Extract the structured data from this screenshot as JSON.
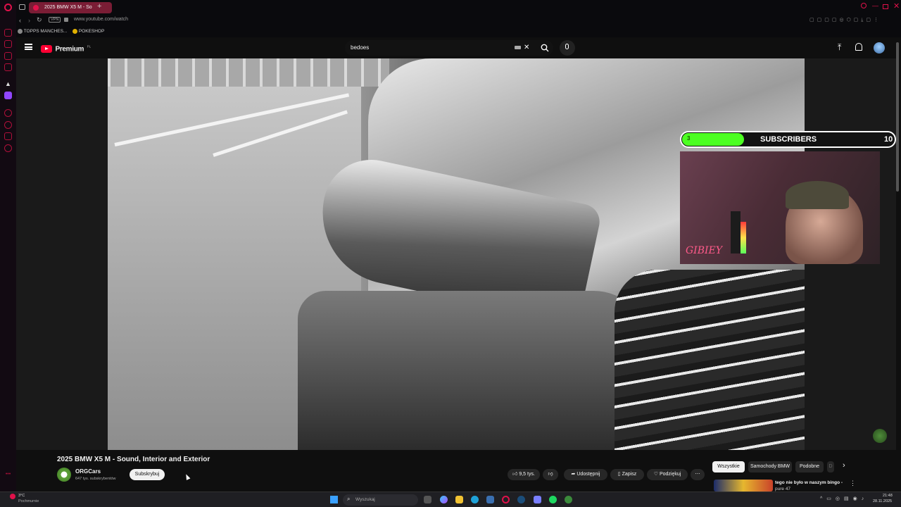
{
  "browser": {
    "tab_title": "2025 BMW X5 M - So",
    "url": "www.youtube.com/watch",
    "vpn_badge": "VPN",
    "bookmarks": [
      "TOPPS MANCHES...",
      "POKESHOP"
    ]
  },
  "header": {
    "logo_text": "Premium",
    "logo_region": "PL",
    "search_value": "bedoes"
  },
  "overlay": {
    "subscribers_current": "3",
    "subscribers_label": "SUBSCRIBERS",
    "subscribers_goal": "10",
    "webcam_caption": "GIBIEY"
  },
  "video": {
    "title": "2025 BMW X5 M - Sound, Interior and Exterior",
    "channel_name": "ORGCars",
    "channel_subs": "647 tys. subskrybentów",
    "subscribe_label": "Subskrybuj",
    "like_count": "9,5 tys.",
    "share_label": "Udostępnij",
    "save_label": "Zapisz",
    "thanks_label": "Podziękuj"
  },
  "chips": [
    "Wszystkie",
    "Samochody BMW",
    "Podobne",
    "D"
  ],
  "recommendation": {
    "title": "tego nie było w naszym bingo -",
    "subtitle": "pure 47"
  },
  "taskbar": {
    "weather_temp": "3°C",
    "weather_desc": "Pochmurnie",
    "search_placeholder": "Wyszukaj",
    "time": "21:48",
    "date": "28.11.2025"
  },
  "colors": {
    "opera_red": "#e0114a",
    "yt_red": "#ff0033",
    "progress_green": "#4cff22",
    "tab_active": "#7a1d35"
  }
}
